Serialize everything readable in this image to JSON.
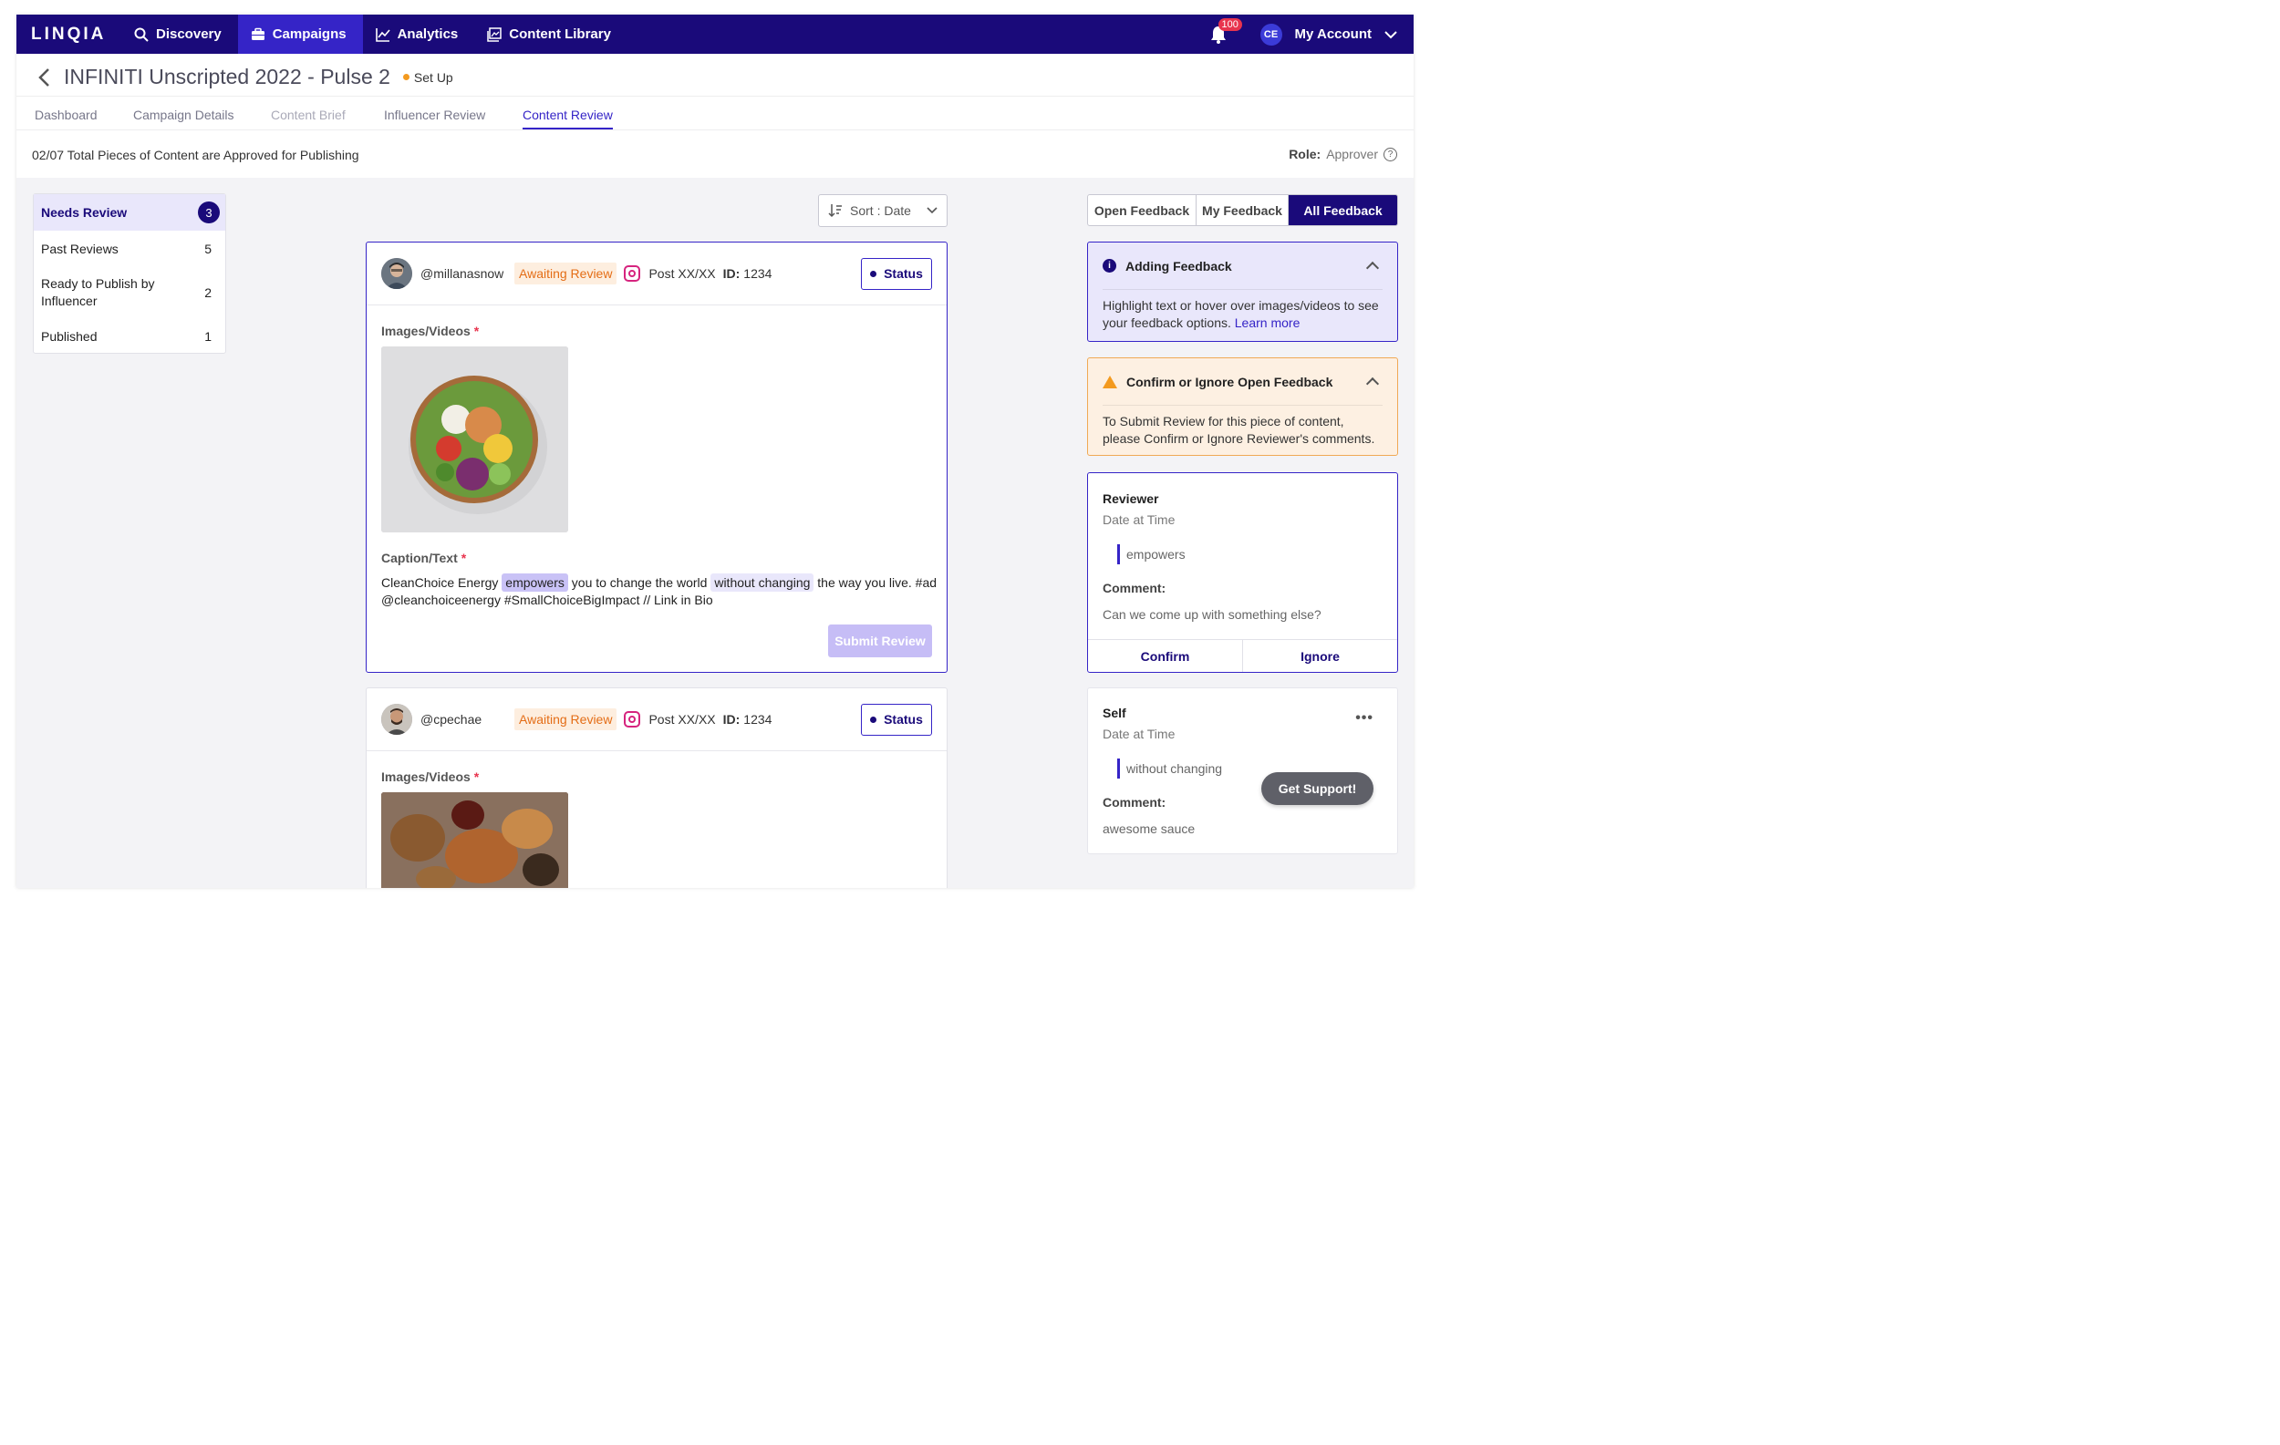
{
  "app": {
    "logo": "LINQIA"
  },
  "nav": {
    "items": [
      {
        "label": "Discovery",
        "icon": "search-icon"
      },
      {
        "label": "Campaigns",
        "icon": "briefcase-icon",
        "active": true
      },
      {
        "label": "Analytics",
        "icon": "chart-icon"
      },
      {
        "label": "Content Library",
        "icon": "library-icon"
      }
    ],
    "notifications_count": "100",
    "avatar_initials": "CE",
    "account_label": "My Account"
  },
  "campaign": {
    "title": "INFINITI Unscripted 2022 - Pulse 2",
    "status": "Set Up",
    "status_color": "#f39a1f"
  },
  "tabs": [
    {
      "label": "Dashboard"
    },
    {
      "label": "Campaign Details"
    },
    {
      "label": "Content Brief"
    },
    {
      "label": "Influencer Review"
    },
    {
      "label": "Content Review",
      "active": true
    }
  ],
  "summary": {
    "text": "02/07 Total Pieces of Content are Approved for Publishing",
    "role_label": "Role:",
    "role_value": "Approver"
  },
  "filters": [
    {
      "label": "Needs Review",
      "count": "3",
      "selected": true
    },
    {
      "label": "Past Reviews",
      "count": "5"
    },
    {
      "label": "Ready to Publish by Influencer",
      "count": "2"
    },
    {
      "label": "Published",
      "count": "1"
    }
  ],
  "sort": {
    "label": "Sort : Date"
  },
  "cards": [
    {
      "handle": "@millanasnow",
      "status": "Awaiting Review",
      "post": "Post XX/XX",
      "id_label": "ID:",
      "id_value": "1234",
      "status_button": "Status",
      "images_label": "Images/Videos",
      "caption_label": "Caption/Text",
      "caption_parts": [
        "CleanChoice Energy ",
        "empowers",
        " you to change the world ",
        "without changing",
        " the way you live. #ad @cleanchoiceenergy #SmallChoiceBigImpact // Link in Bio"
      ],
      "submit_label": "Submit Review"
    },
    {
      "handle": "@cpechae",
      "status": "Awaiting Review",
      "post": "Post XX/XX",
      "id_label": "ID:",
      "id_value": "1234",
      "status_button": "Status",
      "images_label": "Images/Videos"
    }
  ],
  "feedback_tabs": [
    {
      "label": "Open Feedback"
    },
    {
      "label": "My Feedback"
    },
    {
      "label": "All Feedback",
      "active": true
    }
  ],
  "adding_feedback": {
    "title": "Adding Feedback",
    "body": "Highlight text or hover over images/videos to see your feedback options. ",
    "link": "Learn more"
  },
  "confirm_feedback": {
    "title": "Confirm or Ignore Open Feedback",
    "body": "To Submit Review for this piece of content, please Confirm or Ignore Reviewer's comments."
  },
  "feedback_items": [
    {
      "author": "Reviewer",
      "date": "Date at Time",
      "quote": "empowers",
      "comment_label": "Comment:",
      "comment": "Can we come up with something else?",
      "confirm": "Confirm",
      "ignore": "Ignore"
    },
    {
      "author": "Self",
      "date": "Date at Time",
      "quote": "without changing",
      "comment_label": "Comment:",
      "comment": "awesome sauce"
    }
  ],
  "support_button": "Get Support!"
}
